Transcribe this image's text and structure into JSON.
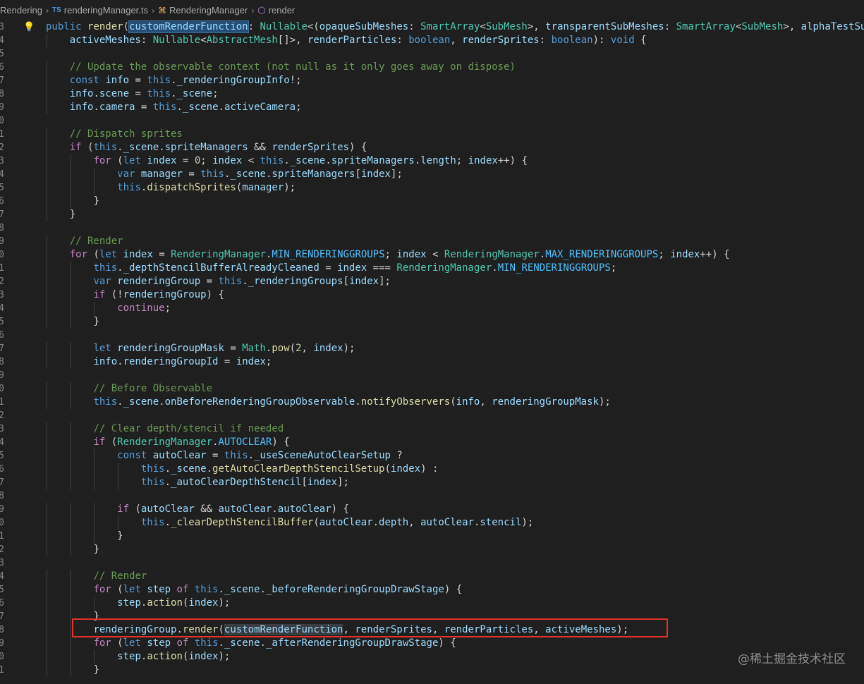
{
  "breadcrumb": {
    "folder": "Rendering",
    "file_icon": "TS",
    "file": "renderingManager.ts",
    "class": "RenderingManager",
    "method": "render"
  },
  "colors": {
    "keyword": "#569cd6",
    "control": "#c586c0",
    "function": "#dcdcaa",
    "variable": "#9cdcfe",
    "type": "#4ec9b0",
    "comment": "#6a9955",
    "highlight_box": "#e0312c"
  },
  "code_lines": [
    {
      "n": "3",
      "t": "public render(customRenderFunction: Nullable<(opaqueSubMeshes: SmartArray<SubMesh>, transparentSubMeshes: SmartArray<SubMesh>, alphaTestSu"
    },
    {
      "n": "4",
      "t": "    activeMeshes: Nullable<AbstractMesh[]>, renderParticles: boolean, renderSprites: boolean): void {"
    },
    {
      "n": "5",
      "t": ""
    },
    {
      "n": "6",
      "t": "    // Update the observable context (not null as it only goes away on dispose)"
    },
    {
      "n": "7",
      "t": "    const info = this._renderingGroupInfo!;"
    },
    {
      "n": "8",
      "t": "    info.scene = this._scene;"
    },
    {
      "n": "9",
      "t": "    info.camera = this._scene.activeCamera;"
    },
    {
      "n": "0",
      "t": ""
    },
    {
      "n": "1",
      "t": "    // Dispatch sprites"
    },
    {
      "n": "2",
      "t": "    if (this._scene.spriteManagers && renderSprites) {"
    },
    {
      "n": "3",
      "t": "        for (let index = 0; index < this._scene.spriteManagers.length; index++) {"
    },
    {
      "n": "4",
      "t": "            var manager = this._scene.spriteManagers[index];"
    },
    {
      "n": "5",
      "t": "            this.dispatchSprites(manager);"
    },
    {
      "n": "6",
      "t": "        }"
    },
    {
      "n": "7",
      "t": "    }"
    },
    {
      "n": "8",
      "t": ""
    },
    {
      "n": "9",
      "t": "    // Render"
    },
    {
      "n": "0",
      "t": "    for (let index = RenderingManager.MIN_RENDERINGGROUPS; index < RenderingManager.MAX_RENDERINGGROUPS; index++) {"
    },
    {
      "n": "1",
      "t": "        this._depthStencilBufferAlreadyCleaned = index === RenderingManager.MIN_RENDERINGGROUPS;"
    },
    {
      "n": "2",
      "t": "        var renderingGroup = this._renderingGroups[index];"
    },
    {
      "n": "3",
      "t": "        if (!renderingGroup) {"
    },
    {
      "n": "4",
      "t": "            continue;"
    },
    {
      "n": "5",
      "t": "        }"
    },
    {
      "n": "6",
      "t": ""
    },
    {
      "n": "7",
      "t": "        let renderingGroupMask = Math.pow(2, index);"
    },
    {
      "n": "8",
      "t": "        info.renderingGroupId = index;"
    },
    {
      "n": "9",
      "t": ""
    },
    {
      "n": "0",
      "t": "        // Before Observable"
    },
    {
      "n": "1",
      "t": "        this._scene.onBeforeRenderingGroupObservable.notifyObservers(info, renderingGroupMask);"
    },
    {
      "n": "2",
      "t": ""
    },
    {
      "n": "3",
      "t": "        // Clear depth/stencil if needed"
    },
    {
      "n": "4",
      "t": "        if (RenderingManager.AUTOCLEAR) {"
    },
    {
      "n": "5",
      "t": "            const autoClear = this._useSceneAutoClearSetup ?"
    },
    {
      "n": "6",
      "t": "                this._scene.getAutoClearDepthStencilSetup(index) :"
    },
    {
      "n": "7",
      "t": "                this._autoClearDepthStencil[index];"
    },
    {
      "n": "8",
      "t": ""
    },
    {
      "n": "9",
      "t": "            if (autoClear && autoClear.autoClear) {"
    },
    {
      "n": "0",
      "t": "                this._clearDepthStencilBuffer(autoClear.depth, autoClear.stencil);"
    },
    {
      "n": "1",
      "t": "            }"
    },
    {
      "n": "2",
      "t": "        }"
    },
    {
      "n": "3",
      "t": ""
    },
    {
      "n": "4",
      "t": "        // Render"
    },
    {
      "n": "5",
      "t": "        for (let step of this._scene._beforeRenderingGroupDrawStage) {"
    },
    {
      "n": "6",
      "t": "            step.action(index);"
    },
    {
      "n": "7",
      "t": "        }"
    },
    {
      "n": "8",
      "t": "        renderingGroup.render(customRenderFunction, renderSprites, renderParticles, activeMeshes);"
    },
    {
      "n": "9",
      "t": "        for (let step of this._scene._afterRenderingGroupDrawStage) {"
    },
    {
      "n": "0",
      "t": "            step.action(index);"
    },
    {
      "n": "1",
      "t": "        }"
    }
  ],
  "watermark": "@稀土掘金技术社区"
}
